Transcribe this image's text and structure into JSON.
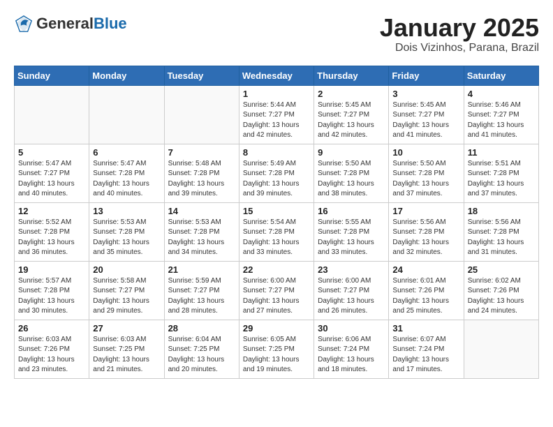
{
  "header": {
    "logo": {
      "general": "General",
      "blue": "Blue"
    },
    "title": "January 2025",
    "subtitle": "Dois Vizinhos, Parana, Brazil"
  },
  "weekdays": [
    "Sunday",
    "Monday",
    "Tuesday",
    "Wednesday",
    "Thursday",
    "Friday",
    "Saturday"
  ],
  "weeks": [
    [
      {
        "day": "",
        "info": ""
      },
      {
        "day": "",
        "info": ""
      },
      {
        "day": "",
        "info": ""
      },
      {
        "day": "1",
        "info": "Sunrise: 5:44 AM\nSunset: 7:27 PM\nDaylight: 13 hours\nand 42 minutes."
      },
      {
        "day": "2",
        "info": "Sunrise: 5:45 AM\nSunset: 7:27 PM\nDaylight: 13 hours\nand 42 minutes."
      },
      {
        "day": "3",
        "info": "Sunrise: 5:45 AM\nSunset: 7:27 PM\nDaylight: 13 hours\nand 41 minutes."
      },
      {
        "day": "4",
        "info": "Sunrise: 5:46 AM\nSunset: 7:27 PM\nDaylight: 13 hours\nand 41 minutes."
      }
    ],
    [
      {
        "day": "5",
        "info": "Sunrise: 5:47 AM\nSunset: 7:27 PM\nDaylight: 13 hours\nand 40 minutes."
      },
      {
        "day": "6",
        "info": "Sunrise: 5:47 AM\nSunset: 7:28 PM\nDaylight: 13 hours\nand 40 minutes."
      },
      {
        "day": "7",
        "info": "Sunrise: 5:48 AM\nSunset: 7:28 PM\nDaylight: 13 hours\nand 39 minutes."
      },
      {
        "day": "8",
        "info": "Sunrise: 5:49 AM\nSunset: 7:28 PM\nDaylight: 13 hours\nand 39 minutes."
      },
      {
        "day": "9",
        "info": "Sunrise: 5:50 AM\nSunset: 7:28 PM\nDaylight: 13 hours\nand 38 minutes."
      },
      {
        "day": "10",
        "info": "Sunrise: 5:50 AM\nSunset: 7:28 PM\nDaylight: 13 hours\nand 37 minutes."
      },
      {
        "day": "11",
        "info": "Sunrise: 5:51 AM\nSunset: 7:28 PM\nDaylight: 13 hours\nand 37 minutes."
      }
    ],
    [
      {
        "day": "12",
        "info": "Sunrise: 5:52 AM\nSunset: 7:28 PM\nDaylight: 13 hours\nand 36 minutes."
      },
      {
        "day": "13",
        "info": "Sunrise: 5:53 AM\nSunset: 7:28 PM\nDaylight: 13 hours\nand 35 minutes."
      },
      {
        "day": "14",
        "info": "Sunrise: 5:53 AM\nSunset: 7:28 PM\nDaylight: 13 hours\nand 34 minutes."
      },
      {
        "day": "15",
        "info": "Sunrise: 5:54 AM\nSunset: 7:28 PM\nDaylight: 13 hours\nand 33 minutes."
      },
      {
        "day": "16",
        "info": "Sunrise: 5:55 AM\nSunset: 7:28 PM\nDaylight: 13 hours\nand 33 minutes."
      },
      {
        "day": "17",
        "info": "Sunrise: 5:56 AM\nSunset: 7:28 PM\nDaylight: 13 hours\nand 32 minutes."
      },
      {
        "day": "18",
        "info": "Sunrise: 5:56 AM\nSunset: 7:28 PM\nDaylight: 13 hours\nand 31 minutes."
      }
    ],
    [
      {
        "day": "19",
        "info": "Sunrise: 5:57 AM\nSunset: 7:28 PM\nDaylight: 13 hours\nand 30 minutes."
      },
      {
        "day": "20",
        "info": "Sunrise: 5:58 AM\nSunset: 7:27 PM\nDaylight: 13 hours\nand 29 minutes."
      },
      {
        "day": "21",
        "info": "Sunrise: 5:59 AM\nSunset: 7:27 PM\nDaylight: 13 hours\nand 28 minutes."
      },
      {
        "day": "22",
        "info": "Sunrise: 6:00 AM\nSunset: 7:27 PM\nDaylight: 13 hours\nand 27 minutes."
      },
      {
        "day": "23",
        "info": "Sunrise: 6:00 AM\nSunset: 7:27 PM\nDaylight: 13 hours\nand 26 minutes."
      },
      {
        "day": "24",
        "info": "Sunrise: 6:01 AM\nSunset: 7:26 PM\nDaylight: 13 hours\nand 25 minutes."
      },
      {
        "day": "25",
        "info": "Sunrise: 6:02 AM\nSunset: 7:26 PM\nDaylight: 13 hours\nand 24 minutes."
      }
    ],
    [
      {
        "day": "26",
        "info": "Sunrise: 6:03 AM\nSunset: 7:26 PM\nDaylight: 13 hours\nand 23 minutes."
      },
      {
        "day": "27",
        "info": "Sunrise: 6:03 AM\nSunset: 7:25 PM\nDaylight: 13 hours\nand 21 minutes."
      },
      {
        "day": "28",
        "info": "Sunrise: 6:04 AM\nSunset: 7:25 PM\nDaylight: 13 hours\nand 20 minutes."
      },
      {
        "day": "29",
        "info": "Sunrise: 6:05 AM\nSunset: 7:25 PM\nDaylight: 13 hours\nand 19 minutes."
      },
      {
        "day": "30",
        "info": "Sunrise: 6:06 AM\nSunset: 7:24 PM\nDaylight: 13 hours\nand 18 minutes."
      },
      {
        "day": "31",
        "info": "Sunrise: 6:07 AM\nSunset: 7:24 PM\nDaylight: 13 hours\nand 17 minutes."
      },
      {
        "day": "",
        "info": ""
      }
    ]
  ]
}
